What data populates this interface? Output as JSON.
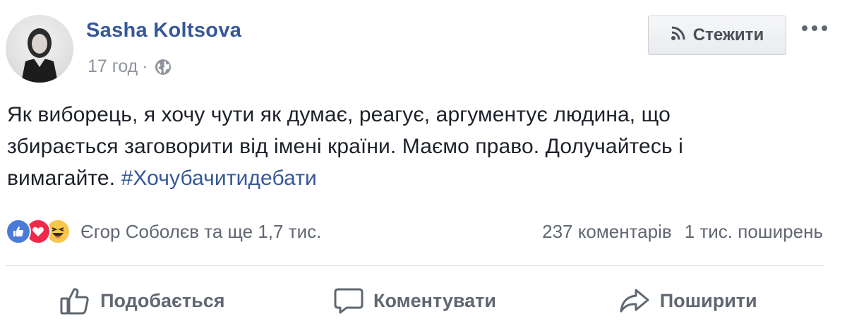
{
  "post": {
    "author": "Sasha Koltsova",
    "time": "17 год",
    "separator": "·",
    "privacy_icon": "globe-icon",
    "follow_label": "Стежити",
    "follow_icon": "rss-icon",
    "more_icon": "more-icon",
    "text_lines": [
      "Як виборець, я хочу чути як думає, реагує, аргументує людина, що",
      "збирається заговорити від імені країни. Маємо право. Долучайтесь і",
      "вимагайте."
    ],
    "hashtag": "#Хочубачитидебати"
  },
  "engagement": {
    "reaction_icons": [
      "like-reaction-icon",
      "love-reaction-icon",
      "haha-reaction-icon"
    ],
    "reactors": "Єгор Соболєв та ще 1,7 тис.",
    "comments": "237 коментарів",
    "shares": "1 тис. поширень"
  },
  "actions": {
    "like": "Подобається",
    "comment": "Коментувати",
    "share": "Поширити"
  },
  "colors": {
    "link": "#365899",
    "muted": "#90949c",
    "action_text": "#606770",
    "like": "#4a7bd6",
    "love": "#f0284a",
    "haha": "#f7c64a"
  }
}
